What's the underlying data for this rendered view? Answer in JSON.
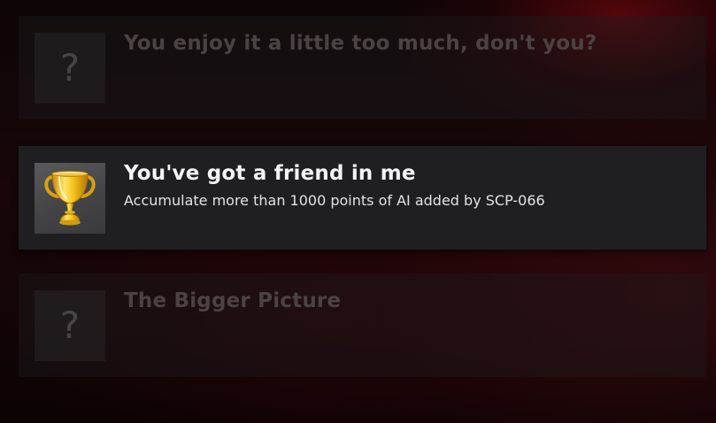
{
  "achievements": [
    {
      "title": "You enjoy it a little too much, don't you?",
      "state": "locked",
      "icon": "question-mark-icon",
      "placeholder_glyph": "?"
    },
    {
      "title": "You've got a friend in me",
      "description": "Accumulate more than 1000 points of AI added by SCP-066",
      "state": "unlocked",
      "icon": "gold-trophy-icon"
    },
    {
      "title": "The Bigger Picture",
      "state": "locked",
      "icon": "question-mark-icon",
      "placeholder_glyph": "?"
    }
  ],
  "colors": {
    "locked_text": "#4b4244",
    "unlocked_title": "#f4f4f4",
    "trophy_gold": "#f2c21a",
    "background_accent": "#6e080e"
  }
}
